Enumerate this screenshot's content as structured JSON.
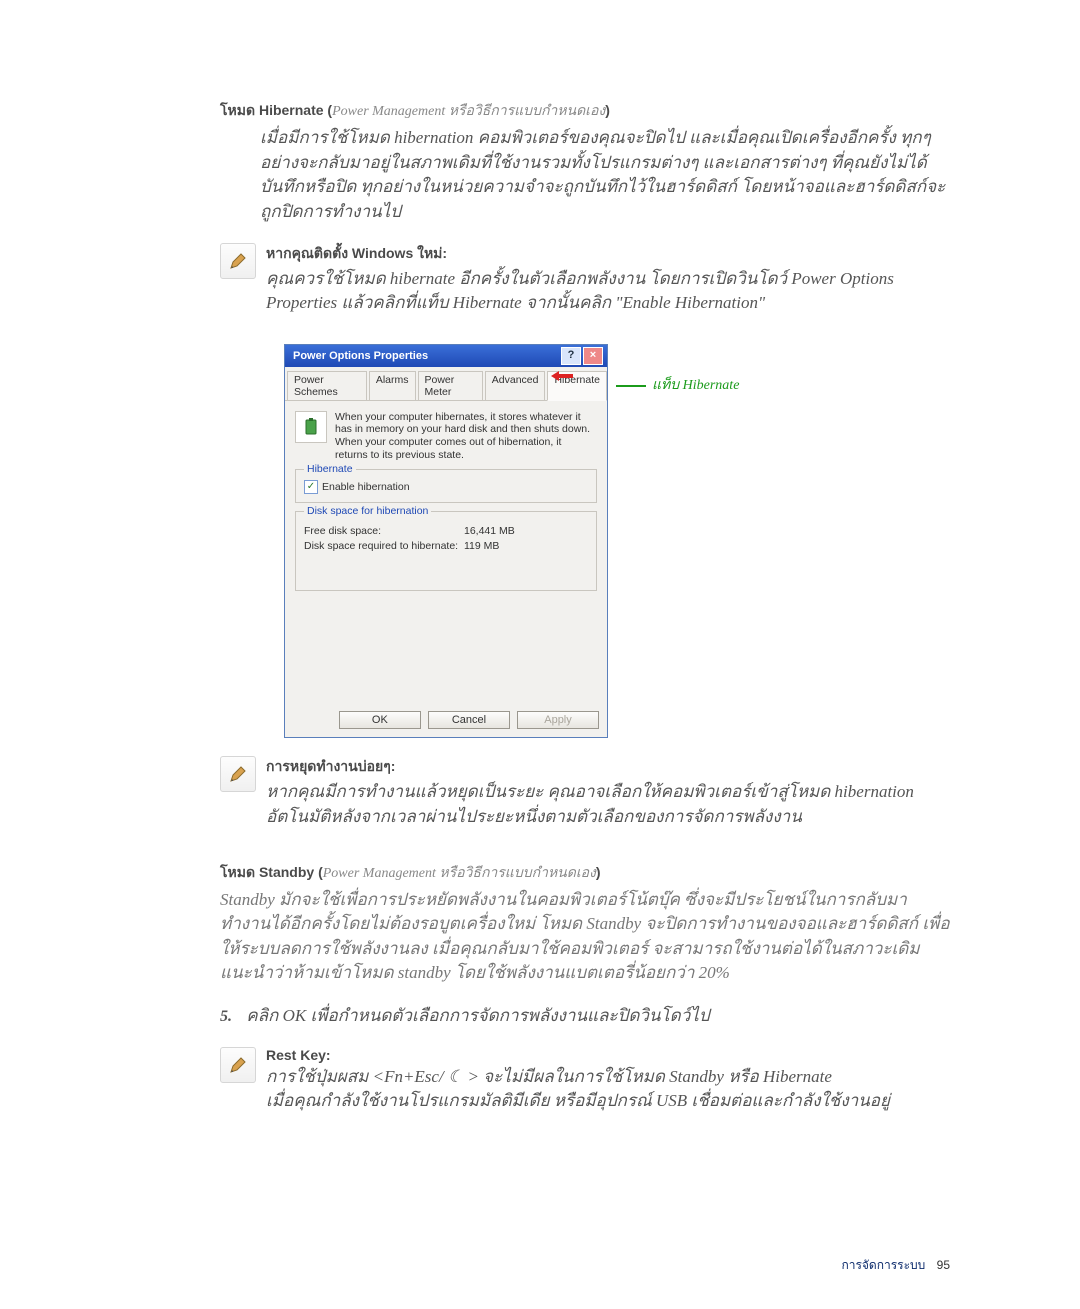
{
  "section_hibernate": {
    "heading_prefix": "โหมด Hibernate (",
    "heading_italic": "Power Management หรือวิธีการแบบกำหนดเอง",
    "heading_suffix": ")",
    "body": "เมื่อมีการใช้โหมด hibernation คอมพิวเตอร์ของคุณจะปิดไป และเมื่อคุณเปิดเครื่องอีกครั้ง ทุกๆ อย่างจะกลับมาอยู่ในสภาพเดิมที่ใช้งานรวมทั้งโปรแกรมต่างๆ และเอกสารต่างๆ ที่คุณยังไม่ได้บันทึกหรือปิด ทุกอย่างในหน่วยความจำจะถูกบันทึกไว้ในฮาร์ดดิสก์ โดยหน้าจอและฮาร์ดดิสก์จะถูกปิดการทำงานไป"
  },
  "note_reinstall": {
    "heading": "หากคุณติดตั้ง Windows ใหม่:",
    "body": "คุณควรใช้โหมด hibernate อีกครั้งในตัวเลือกพลังงาน โดยการเปิดวินโดว์ Power Options Properties  แล้วคลิกที่แท็บ Hibernate จากนั้นคลิก \"Enable Hibernation\""
  },
  "dialog": {
    "title": "Power Options Properties",
    "tabs": [
      "Power Schemes",
      "Alarms",
      "Power Meter",
      "Advanced",
      "Hibernate"
    ],
    "top_desc": "When your computer hibernates, it stores whatever it has in memory on your hard disk and then shuts down. When your computer comes out of hibernation, it returns to its previous state.",
    "group1_legend": "Hibernate",
    "enable_label": "Enable hibernation",
    "group2_legend": "Disk space for hibernation",
    "free_label": "Free disk space:",
    "free_value": "16,441 MB",
    "req_label": "Disk space required to hibernate:",
    "req_value": "119 MB",
    "btn_ok": "OK",
    "btn_cancel": "Cancel",
    "btn_apply": "Apply",
    "callout": "แท็บ Hibernate"
  },
  "note_stop": {
    "heading": "การหยุดทำงานบ่อยๆ:",
    "body": "หากคุณมีการทำงานแล้วหยุดเป็นระยะ คุณอาจเลือกให้คอมพิวเตอร์เข้าสู่โหมด hibernation อัตโนมัติหลังจากเวลาผ่านไประยะหนึ่งตามตัวเลือกของการจัดการพลังงาน"
  },
  "section_standby": {
    "heading_prefix": "โหมด Standby (",
    "heading_italic": "Power Management หรือวิธีการแบบกำหนดเอง",
    "heading_suffix": ")",
    "body": "Standby มักจะใช้เพื่อการประหยัดพลังงานในคอมพิวเตอร์โน้ตบุ๊ค ซึ่งจะมีประโยชน์ในการกลับมาทำงานได้อีกครั้งโดยไม่ต้องรอบูตเครื่องใหม่ โหมด Standby จะปิดการทำงานของจอและฮาร์ดดิสก์ เพื่อให้ระบบลดการใช้พลังงานลง เมื่อคุณกลับมาใช้คอมพิวเตอร์ จะสามารถใช้งานต่อได้ในสภาวะเดิม แนะนำว่าห้ามเข้าโหมด standby โดยใช้พลังงานแบตเตอรี่น้อยกว่า 20%"
  },
  "step5": {
    "num": "5.",
    "text": "คลิก OK เพื่อกำหนดตัวเลือกการจัดการพลังงานและปิดวินโดว์ไป"
  },
  "note_rest": {
    "heading": "Rest Key:",
    "body_line1_pre": "การใช้ปุ่มผสม <Fn+Esc/ ",
    "body_line1_post": " > จะไม่มีผลในการใช้โหมด Standby หรือ Hibernate",
    "body_line2": "เมื่อคุณกำลังใช้งานโปรแกรมมัลติมีเดีย หรือมีอุปกรณ์ USB เชื่อมต่อและกำลังใช้งานอยู่"
  },
  "footer": {
    "label": "การจัดการระบบ",
    "page": "95"
  },
  "icons": {
    "pencil": "pencil-icon",
    "battery": "battery-icon",
    "help": "?",
    "close": "×",
    "check": "✓",
    "moon": "☾"
  }
}
